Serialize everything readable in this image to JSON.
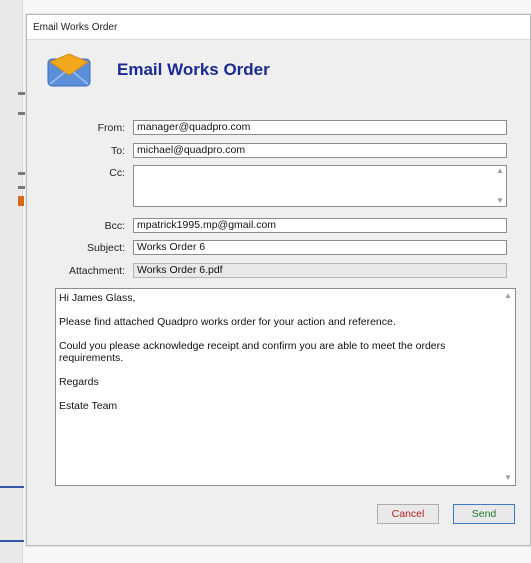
{
  "window": {
    "title": "Email Works Order"
  },
  "header": {
    "title": "Email Works Order",
    "icon": "envelope-icon"
  },
  "fields": {
    "from": {
      "label": "From:",
      "value": "manager@quadpro.com"
    },
    "to": {
      "label": "To:",
      "value": "michael@quadpro.com"
    },
    "cc": {
      "label": "Cc:",
      "value": ""
    },
    "bcc": {
      "label": "Bcc:",
      "value": "mpatrick1995.mp@gmail.com"
    },
    "subject": {
      "label": "Subject:",
      "value": "Works Order 6"
    },
    "attachment": {
      "label": "Attachment:",
      "value": "Works Order 6.pdf"
    }
  },
  "message": {
    "paragraphs": [
      "Hi James Glass,",
      "Please find attached Quadpro works order for your action and reference.",
      "Could you please acknowledge receipt and confirm you are able to meet the orders requirements.",
      "Regards",
      "Estate Team"
    ]
  },
  "buttons": {
    "cancel": "Cancel",
    "send": "Send"
  },
  "colors": {
    "title_blue": "#1b2b93",
    "cancel_red": "#b22222",
    "send_green": "#1f7a2a",
    "envelope_orange": "#f2a81d",
    "envelope_blue": "#5b8fd9"
  }
}
